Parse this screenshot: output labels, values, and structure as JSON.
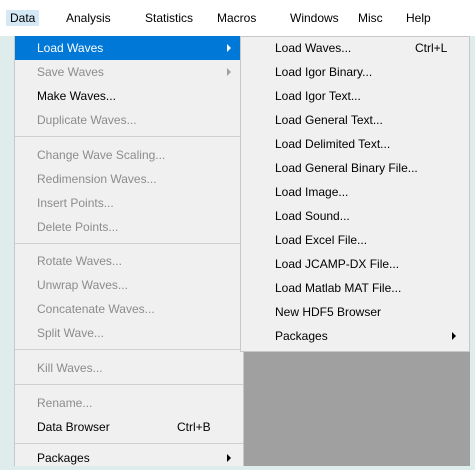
{
  "menubar": {
    "items": [
      "Data",
      "Analysis",
      "Statistics",
      "Macros",
      "Windows",
      "Misc",
      "Help"
    ]
  },
  "data_menu": {
    "items": [
      {
        "label": "Load Waves",
        "state": "highlighted",
        "has_submenu": true
      },
      {
        "label": "Save Waves",
        "state": "disabled",
        "has_submenu": true
      },
      {
        "label": "Make Waves...",
        "state": "enabled"
      },
      {
        "label": "Duplicate Waves...",
        "state": "disabled"
      },
      {
        "label": "Change Wave Scaling...",
        "state": "disabled"
      },
      {
        "label": "Redimension Waves...",
        "state": "disabled"
      },
      {
        "label": "Insert Points...",
        "state": "disabled"
      },
      {
        "label": "Delete Points...",
        "state": "disabled"
      },
      {
        "label": "Rotate Waves...",
        "state": "disabled"
      },
      {
        "label": "Unwrap Waves...",
        "state": "disabled"
      },
      {
        "label": "Concatenate Waves...",
        "state": "disabled"
      },
      {
        "label": "Split Wave...",
        "state": "disabled"
      },
      {
        "label": "Kill Waves...",
        "state": "disabled"
      },
      {
        "label": "Rename...",
        "state": "disabled"
      },
      {
        "label": "Data Browser",
        "state": "enabled",
        "shortcut": "Ctrl+B"
      },
      {
        "label": "Packages",
        "state": "enabled",
        "has_submenu": true
      }
    ]
  },
  "load_waves_submenu": {
    "items": [
      {
        "label": "Load Waves...",
        "shortcut": "Ctrl+L"
      },
      {
        "label": "Load Igor Binary..."
      },
      {
        "label": "Load Igor Text..."
      },
      {
        "label": "Load General Text..."
      },
      {
        "label": "Load Delimited Text..."
      },
      {
        "label": "Load General Binary File..."
      },
      {
        "label": "Load Image..."
      },
      {
        "label": "Load Sound..."
      },
      {
        "label": "Load Excel File..."
      },
      {
        "label": "Load JCAMP-DX File..."
      },
      {
        "label": "Load Matlab MAT File..."
      },
      {
        "label": "New HDF5 Browser"
      },
      {
        "label": "Packages",
        "has_submenu": true
      }
    ]
  },
  "colors": {
    "highlight": "#0078d7",
    "menu_bg": "#f0f0f0",
    "disabled_text": "#8c8c8c",
    "background": "#dfecec",
    "workspace": "#a0a0a0"
  }
}
